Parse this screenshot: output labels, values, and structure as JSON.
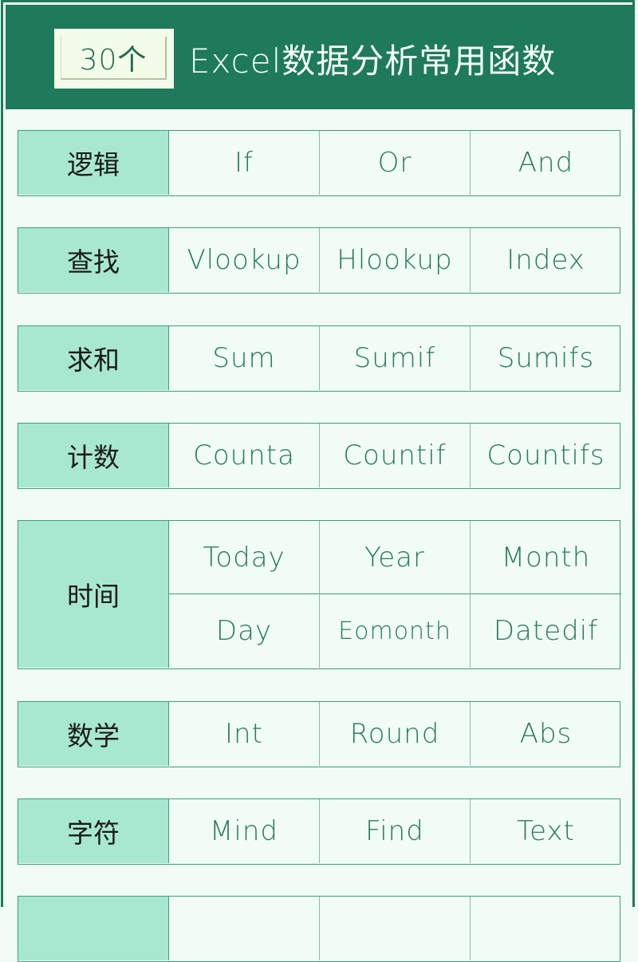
{
  "header": {
    "badge": "30个",
    "title": "Excel数据分析常用函数"
  },
  "groups": [
    {
      "category": "逻辑",
      "functions": [
        "If",
        "Or",
        "And"
      ]
    },
    {
      "category": "查找",
      "functions": [
        "Vlookup",
        "Hlookup",
        "Index"
      ]
    },
    {
      "category": "求和",
      "functions": [
        "Sum",
        "Sumif",
        "Sumifs"
      ]
    },
    {
      "category": "计数",
      "functions": [
        "Counta",
        "Countif",
        "Countifs"
      ]
    },
    {
      "category": "时间",
      "functions": [
        "Today",
        "Year",
        "Month",
        "Day",
        "Eomonth",
        "Datedif"
      ]
    },
    {
      "category": "数学",
      "functions": [
        "Int",
        "Round",
        "Abs"
      ]
    },
    {
      "category": "字符",
      "functions": [
        "Mind",
        "Find",
        "Text"
      ]
    },
    {
      "category": "",
      "functions": [
        "",
        "",
        ""
      ]
    }
  ],
  "colors": {
    "header_bg": "#1e7a5a",
    "category_bg": "#a8e8cf",
    "cell_bg": "#f0fcf5",
    "border": "#3aa080",
    "function_text": "#2a7a5e"
  }
}
